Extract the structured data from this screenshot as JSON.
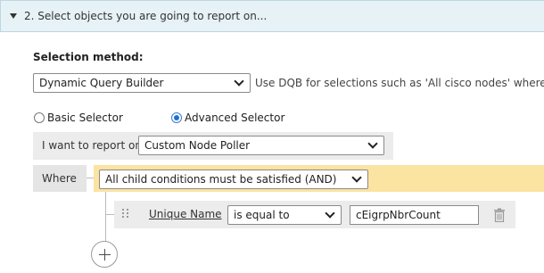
{
  "section": {
    "title": "2. Select objects you are going to report on..."
  },
  "selection_method": {
    "label": "Selection method:",
    "value": "Dynamic Query Builder",
    "hint": "Use DQB for selections such as 'All cisco nodes' where"
  },
  "selector_mode": {
    "basic_label": "Basic Selector",
    "advanced_label": "Advanced Selector",
    "selected": "Advanced Selector"
  },
  "report_on": {
    "label": "I want to report on",
    "value": "Custom Node Poller"
  },
  "where": {
    "label": "Where",
    "condition_group": "All child conditions must be satisfied (AND)"
  },
  "condition": {
    "field": "Unique Name",
    "operator": "is equal to",
    "value": "cEigrpNbrCount"
  },
  "colors": {
    "header_bg": "#e7f2f7",
    "condition_group_bg": "#fbe3a2",
    "row_bg": "#ececec",
    "radio_accent": "#1f6fd1"
  },
  "icons": [
    "collapse-triangle-icon",
    "chevron-down-icon",
    "drag-handle-icon",
    "trash-icon",
    "add-icon"
  ]
}
